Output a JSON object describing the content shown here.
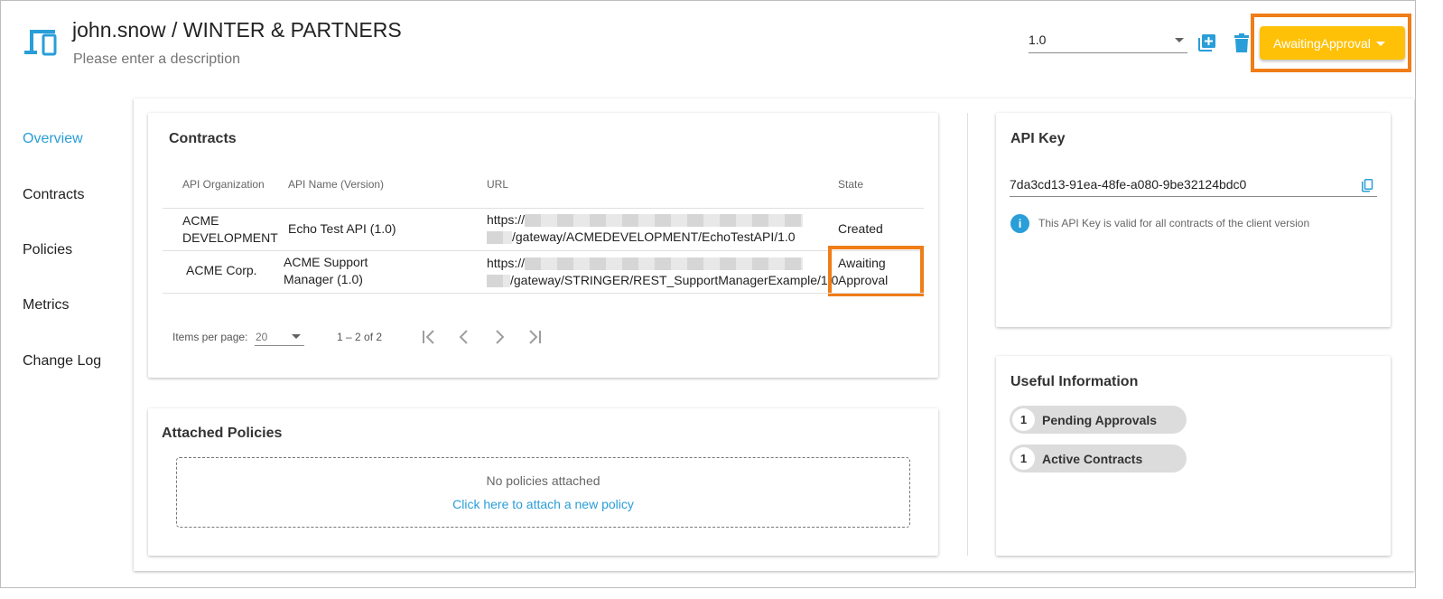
{
  "header": {
    "title": "john.snow / WINTER & PARTNERS",
    "description": "Please enter a description",
    "version": "1.0",
    "status_button": "AwaitingApproval"
  },
  "nav": {
    "items": [
      "Overview",
      "Contracts",
      "Policies",
      "Metrics",
      "Change Log"
    ],
    "active": "Overview"
  },
  "contracts": {
    "title": "Contracts",
    "columns": [
      "API Organization",
      "API Name (Version)",
      "URL",
      "State"
    ],
    "rows": [
      {
        "org": "ACME DEVELOPMENT",
        "org_lines": [
          "ACME",
          "DEVELOPMENT"
        ],
        "api_name": "Echo Test API (1.0)",
        "api_lines": [
          "Echo Test API (1.0)"
        ],
        "url_prefix": "https://",
        "url_path": "/gateway/ACMEDEVELOPMENT/EchoTestAPI/1.0",
        "state": "Created",
        "state_lines": [
          "Created"
        ]
      },
      {
        "org": "ACME Corp.",
        "org_lines": [
          "ACME Corp."
        ],
        "api_name": "ACME Support Manager (1.0)",
        "api_lines": [
          "ACME Support",
          "Manager (1.0)"
        ],
        "url_prefix": "https://",
        "url_path": "/gateway/STRINGER/REST_SupportManagerExample/1.0",
        "state": "Awaiting Approval",
        "state_lines": [
          "Awaiting",
          "Approval"
        ]
      }
    ],
    "pagination": {
      "items_per_page_label": "Items per page:",
      "items_per_page": "20",
      "range": "1 – 2 of 2"
    }
  },
  "policies": {
    "title": "Attached Policies",
    "empty_text": "No policies attached",
    "attach_link": "Click here to attach a new policy"
  },
  "api_key": {
    "title": "API Key",
    "value": "7da3cd13-91ea-48fe-a080-9be32124bdc0",
    "info": "This API Key is valid for all contracts of the client version"
  },
  "useful_info": {
    "title": "Useful Information",
    "chips": [
      {
        "count": "1",
        "label": "Pending Approvals"
      },
      {
        "count": "1",
        "label": "Active Contracts"
      }
    ]
  },
  "colors": {
    "accent": "#2a9ed8",
    "status_button": "#ffc107",
    "highlight": "#ef7d18"
  },
  "icons": [
    "devices-icon",
    "chevron-down-icon",
    "library-add-icon",
    "delete-icon",
    "first-page-icon",
    "chevron-left-icon",
    "chevron-right-icon",
    "last-page-icon",
    "copy-icon",
    "info-icon"
  ]
}
